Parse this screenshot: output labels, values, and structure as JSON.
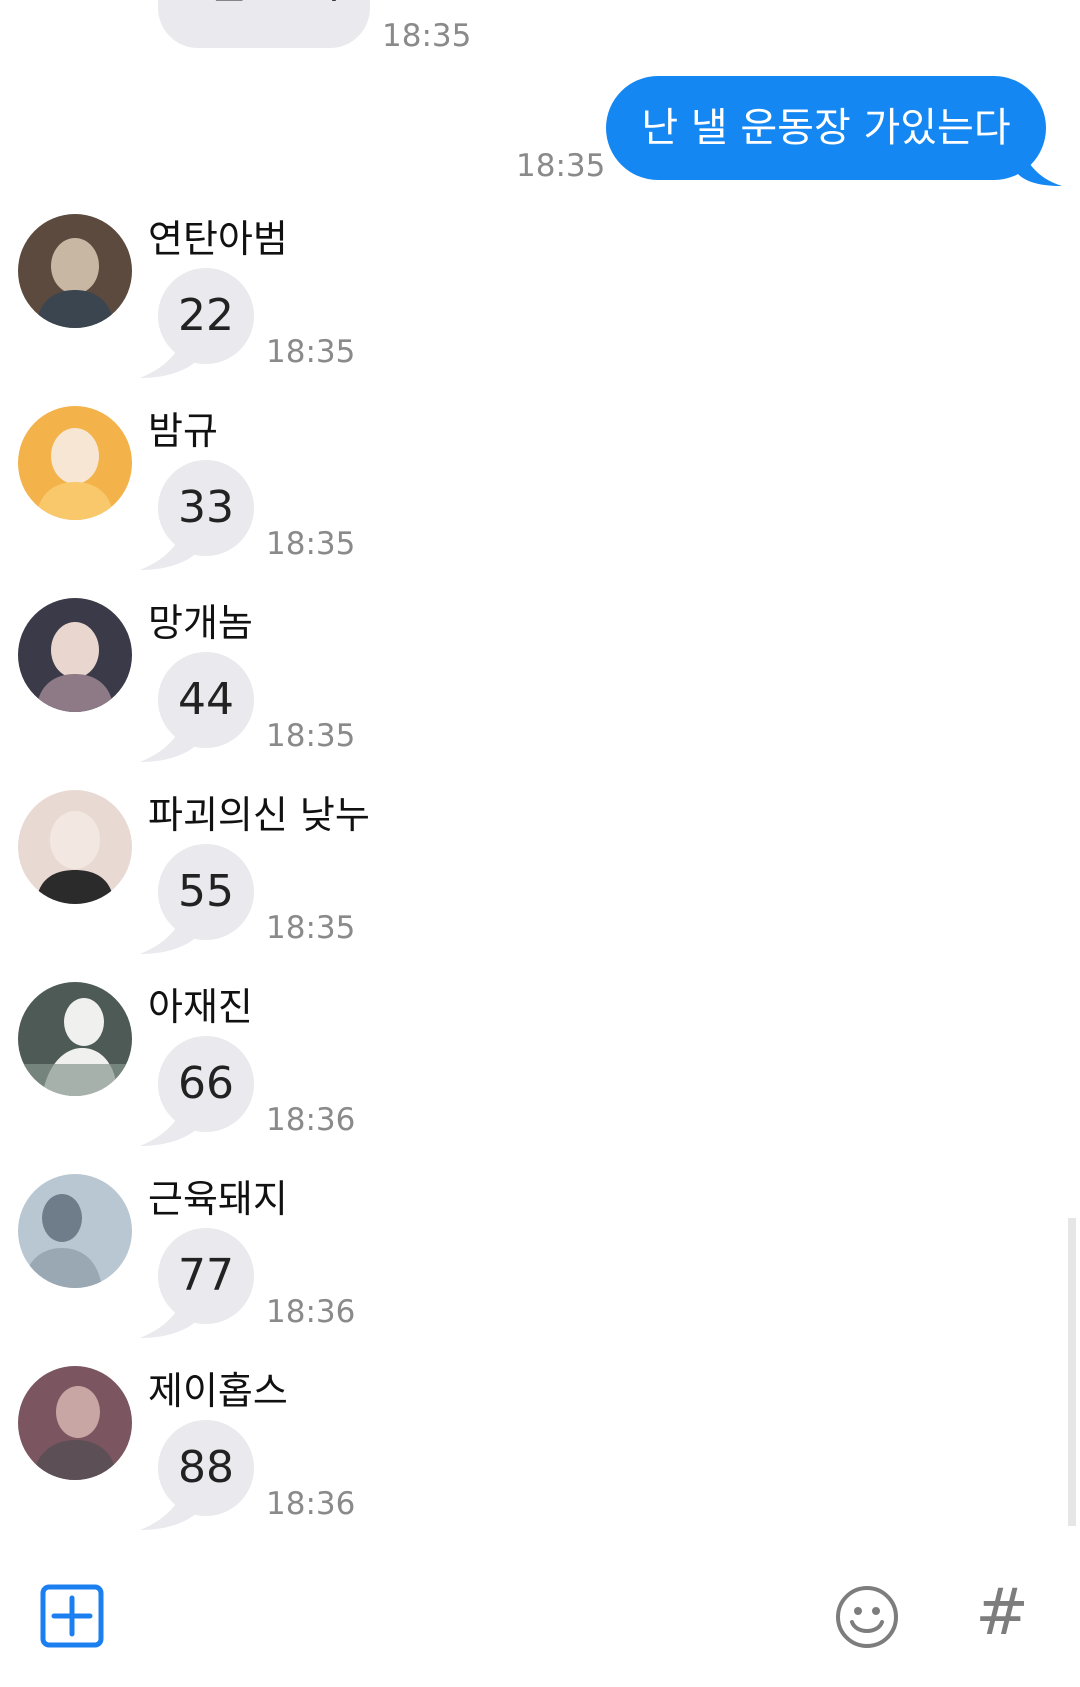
{
  "top_message": {
    "text": "잘 보자",
    "time": "18:35"
  },
  "outgoing": {
    "text": "난 낼 운동장 가있는다",
    "time": "18:35"
  },
  "messages": [
    {
      "name": "연탄아범",
      "text": "22",
      "time": "18:35",
      "avatar_colors": [
        "#5b4a3d",
        "#c8b7a3",
        "#3a4550"
      ]
    },
    {
      "name": "밤규",
      "text": "33",
      "time": "18:35",
      "avatar_colors": [
        "#f3b24a",
        "#f7e6d3",
        "#f8c86a"
      ]
    },
    {
      "name": "망개놈",
      "text": "44",
      "time": "18:35",
      "avatar_colors": [
        "#3a3a48",
        "#e9d6cf",
        "#8d7a86"
      ]
    },
    {
      "name": "파괴의신 낮누",
      "text": "55",
      "time": "18:35",
      "avatar_colors": [
        "#e8d9d3",
        "#f3e7e2",
        "#2b2b2b"
      ]
    },
    {
      "name": "아재진",
      "text": "66",
      "time": "18:36",
      "avatar_colors": [
        "#4d5a56",
        "#f0f0ee",
        "#86968f"
      ]
    },
    {
      "name": "근육돼지",
      "text": "77",
      "time": "18:36",
      "avatar_colors": [
        "#6f7d8a",
        "#b9c7d2",
        "#9aa8b4"
      ]
    },
    {
      "name": "제이홉스",
      "text": "88",
      "time": "18:36",
      "avatar_colors": [
        "#7b5560",
        "#c8a6a3",
        "#5d4f56"
      ]
    }
  ],
  "bottom_bar": {
    "add_icon": "plus-square-icon",
    "emoji_icon": "smiley-icon",
    "hash_label": "#"
  },
  "colors": {
    "outgoing_bubble": "#1487f3",
    "incoming_bubble": "#e9e9ee",
    "accent": "#1c7ff0"
  }
}
